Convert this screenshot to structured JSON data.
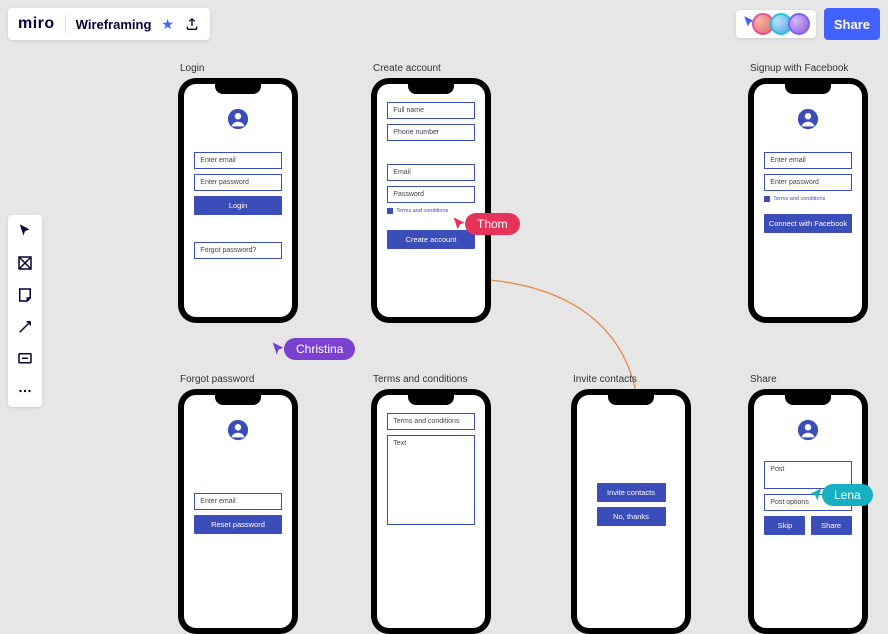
{
  "header": {
    "logo": "miro",
    "board_name": "Wireframing",
    "share_label": "Share"
  },
  "cursors": {
    "thom": "Thom",
    "christina": "Christina",
    "lena": "Lena"
  },
  "frames": {
    "login": {
      "label": "Login",
      "inputs": {
        "email": "Enter email",
        "password": "Enter password"
      },
      "button": "Login",
      "forgot": "Forgot password?"
    },
    "create": {
      "label": "Create account",
      "inputs": {
        "fullname": "Full name",
        "phone": "Phone number",
        "email": "Email",
        "password": "Password"
      },
      "check": "Terms and conditions",
      "button": "Create account"
    },
    "fb": {
      "label": "Signup with Facebook",
      "inputs": {
        "email": "Enter email",
        "password": "Enter password"
      },
      "check": "Terms and conditions",
      "button": "Connect with Facebook"
    },
    "forgot": {
      "label": "Forgot password",
      "inputs": {
        "email": "Enter email"
      },
      "button": "Reset password"
    },
    "terms": {
      "label": "Terms and conditions",
      "title": "Terms and conditions",
      "body": "Text"
    },
    "invite": {
      "label": "Invite contacts",
      "button1": "Invite contacts",
      "button2": "No, thanks"
    },
    "share": {
      "label": "Share",
      "inputs": {
        "post": "Post",
        "options": "Post options"
      },
      "button1": "Skip",
      "button2": "Share"
    }
  }
}
